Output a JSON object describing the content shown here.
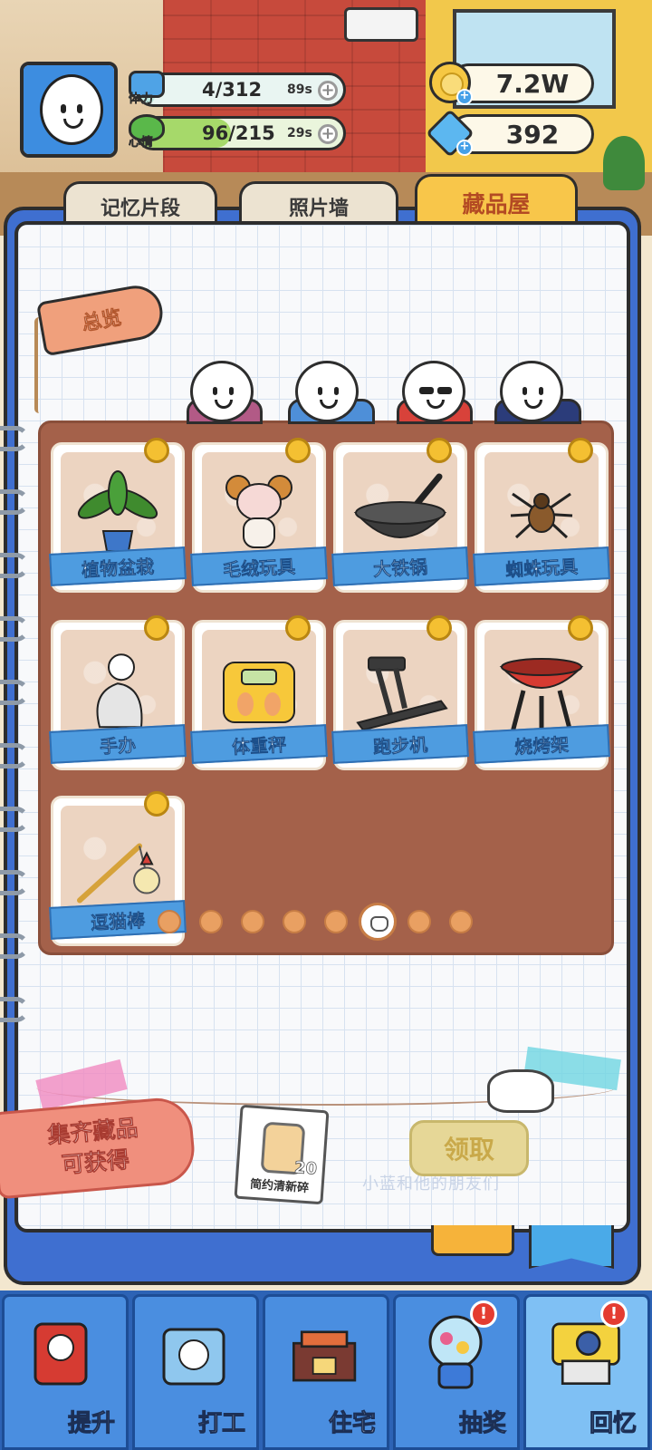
{
  "player": {
    "stamina": {
      "label": "体力",
      "value": "4/312",
      "timer": "89s",
      "fill": 0.013
    },
    "mood": {
      "label": "心情",
      "value": "96/215",
      "timer": "29s",
      "fill": 0.45
    }
  },
  "currency": {
    "coins": "7.2W",
    "gems": "392"
  },
  "tabs": [
    {
      "label": "记忆片段",
      "active": false
    },
    {
      "label": "照片墙",
      "active": false
    },
    {
      "label": "藏品屋",
      "active": true
    }
  ],
  "summary_tag": "总览",
  "collection": {
    "items": [
      {
        "name": "植物盆栽",
        "icon": "potted-plant-icon"
      },
      {
        "name": "毛绒玩具",
        "icon": "plush-toy-icon"
      },
      {
        "name": "大铁锅",
        "icon": "wok-icon"
      },
      {
        "name": "蜘蛛玩具",
        "icon": "spider-toy-icon"
      },
      {
        "name": "手办",
        "icon": "figurine-icon"
      },
      {
        "name": "体重秤",
        "icon": "scale-icon"
      },
      {
        "name": "跑步机",
        "icon": "treadmill-icon"
      },
      {
        "name": "烧烤架",
        "icon": "grill-icon"
      },
      {
        "name": "逗猫棒",
        "icon": "cat-teaser-icon"
      }
    ],
    "pages": 8,
    "active_page": 6
  },
  "reward": {
    "tag_line1": "集齐藏品",
    "tag_line2": "可获得",
    "item_name": "简约清新碎",
    "item_qty": "20",
    "claim_label": "领取",
    "watermark": "小蓝和他的朋友们"
  },
  "bottom_nav": [
    {
      "label": "提升",
      "badge": false
    },
    {
      "label": "打工",
      "badge": false
    },
    {
      "label": "住宅",
      "badge": false
    },
    {
      "label": "抽奖",
      "badge": true
    },
    {
      "label": "回忆",
      "badge": true
    }
  ],
  "colors": {
    "accent_blue": "#4e9ce0",
    "board_brown": "#a4614a",
    "tab_active": "#f8c64a",
    "badge_red": "#e43c31"
  }
}
